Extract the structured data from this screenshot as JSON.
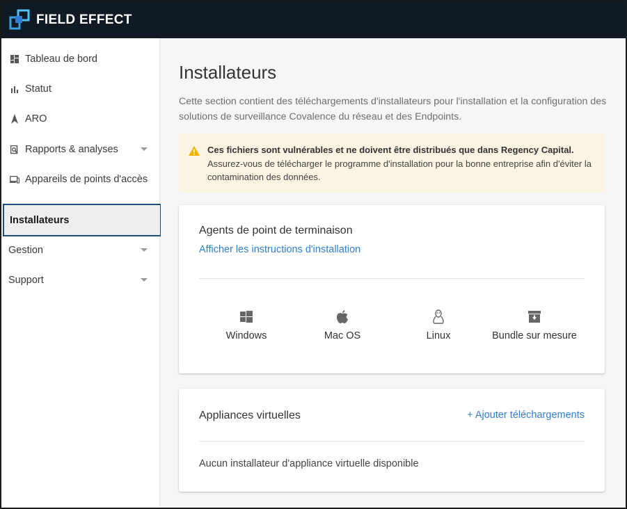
{
  "app": {
    "brand": "FIELD EFFECT",
    "accent": "#2f7ed3",
    "topbar_color": "#0f1a25"
  },
  "sidebar": {
    "items": [
      {
        "label": "Tableau de bord",
        "icon": "dashboard-icon"
      },
      {
        "label": "Statut",
        "icon": "bar-chart-icon"
      },
      {
        "label": "ARO",
        "icon": "aro-icon"
      },
      {
        "label": "Rapports & analyses",
        "icon": "report-search-icon",
        "expandable": true
      },
      {
        "label": "Appareils de points d'accès",
        "icon": "devices-icon"
      },
      {
        "label": "Installateurs",
        "active": true
      },
      {
        "label": "Gestion",
        "expandable": true
      },
      {
        "label": "Support",
        "expandable": true
      }
    ]
  },
  "main": {
    "title": "Installateurs",
    "intro_line1": "Cette section contient des téléchargements d'installateurs pour l'installation et la configuration des",
    "intro_line2": "solutions de surveillance Covalence du réseau et des Endpoints.",
    "warning": {
      "title": "Ces fichiers sont vulnérables et ne doivent être distribués que dans Regency Capital.",
      "line2": "Assurez-vous de télécharger le programme d'installation pour la bonne entreprise afin d'éviter la",
      "line3": "contamination des données."
    },
    "agents_card": {
      "title": "Agents de point de terminaison",
      "link": "Afficher les instructions d'installation",
      "platforms": [
        {
          "label": "Windows",
          "icon": "windows-icon"
        },
        {
          "label": "Mac OS",
          "icon": "apple-icon"
        },
        {
          "label": "Linux",
          "icon": "linux-icon"
        },
        {
          "label": "Bundle sur mesure",
          "icon": "archive-download-icon"
        }
      ]
    },
    "appliances_card": {
      "title": "Appliances virtuelles",
      "add_link": "+ Ajouter téléchargements",
      "empty": "Aucun installateur d'appliance virtuelle disponible"
    }
  }
}
